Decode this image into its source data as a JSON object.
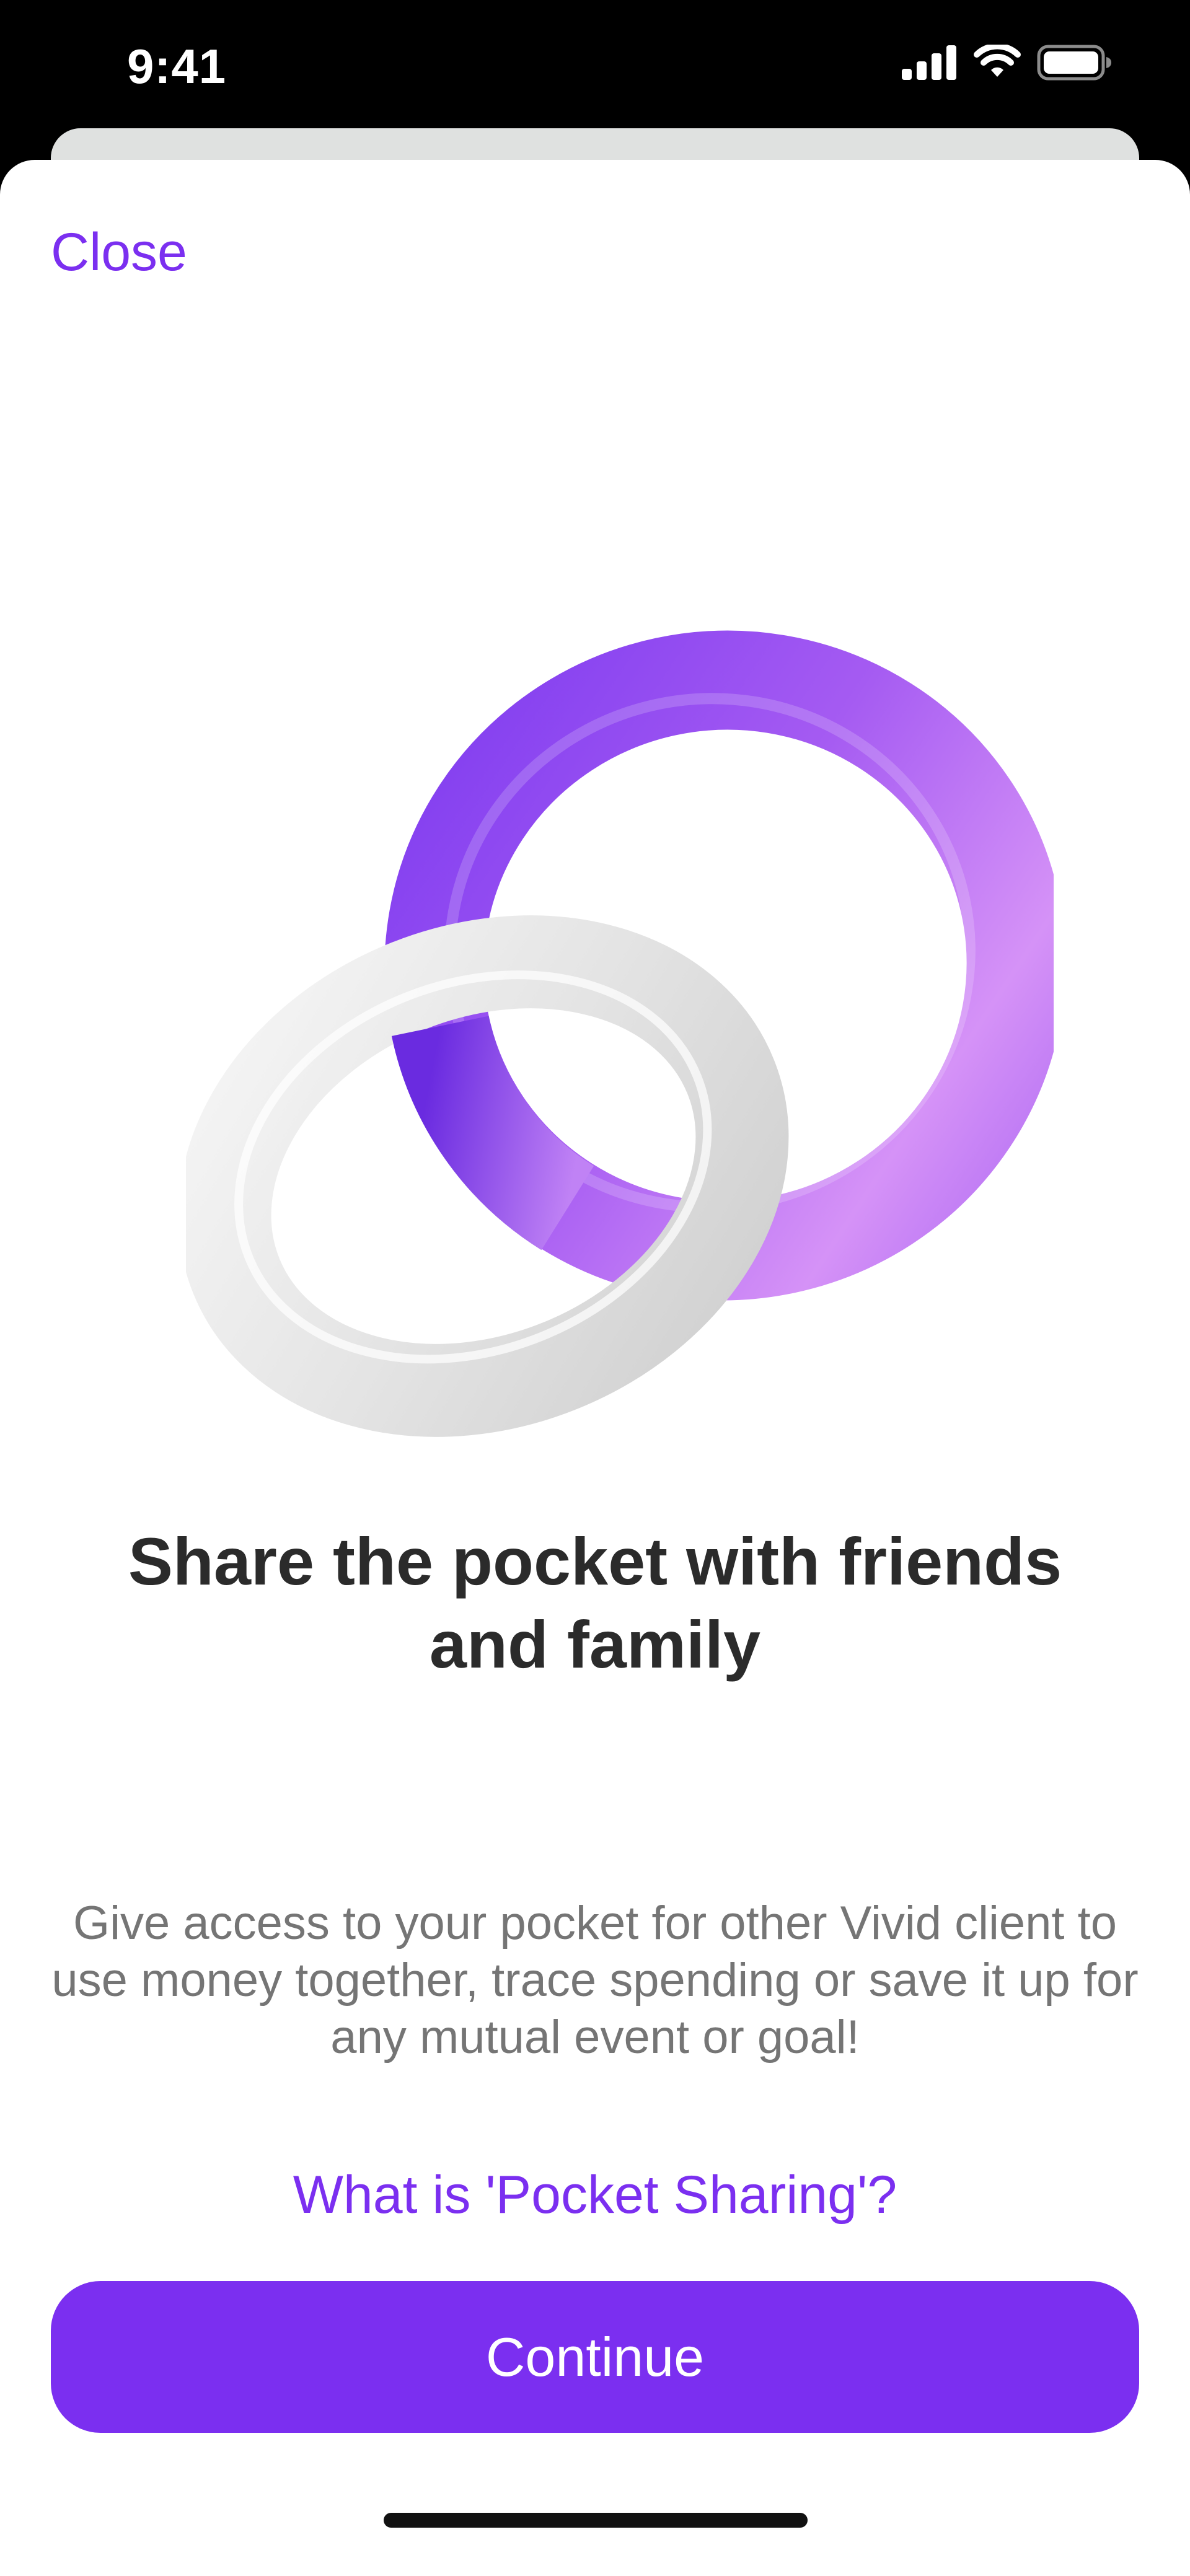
{
  "status_bar": {
    "time": "9:41",
    "icons": [
      "signal-icon",
      "wifi-icon",
      "battery-icon"
    ]
  },
  "header": {
    "close_label": "Close"
  },
  "illustration": {
    "name": "linked-rings-icon",
    "colors": {
      "purple_ring": "#9d55f0",
      "white_ring": "#e9e9e9"
    }
  },
  "content": {
    "title": "Share the pocket with friends and family",
    "description": "Give access to your pocket for other Vivid client to use money together, trace spending or save it up for any mutual event or goal!",
    "info_link": "What is 'Pocket Sharing'?"
  },
  "footer": {
    "continue_label": "Continue"
  },
  "colors": {
    "accent": "#7b2ff0",
    "title": "#2b2b2b",
    "body_text": "#757575",
    "background": "#ffffff",
    "status_bar": "#000000"
  }
}
